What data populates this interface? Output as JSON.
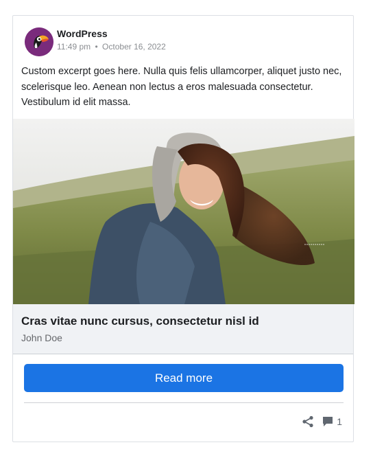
{
  "post": {
    "author": "WordPress",
    "time": "11:49 pm",
    "separator": "•",
    "date": "October 16, 2022",
    "excerpt": "Custom excerpt goes here. Nulla quis felis ullamcorper, aliquet justo nec, scelerisque leo. Aenean non lectus a eros malesuada consectetur. Vestibulum id elit massa."
  },
  "link_preview": {
    "title": "Cras vitae nunc cursus, consectetur nisl id",
    "author": "John Doe"
  },
  "actions": {
    "read_more_label": "Read more",
    "share_icon": "share-icon",
    "comment_icon": "comment-icon",
    "comment_count": "1"
  },
  "colors": {
    "accent": "#1b74e4",
    "avatar_bg": "#7a2b7c",
    "preview_bg": "#f0f2f5"
  }
}
